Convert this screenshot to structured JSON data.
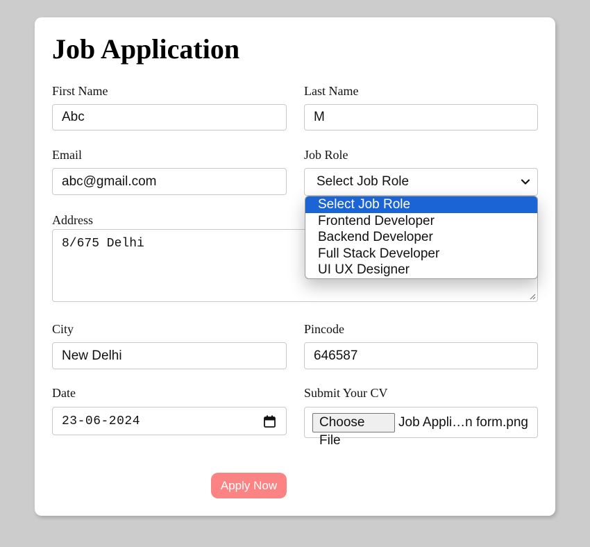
{
  "form": {
    "title": "Job Application",
    "first_name": {
      "label": "First Name",
      "value": "Abc"
    },
    "last_name": {
      "label": "Last Name",
      "value": "M"
    },
    "email": {
      "label": "Email",
      "value": "abc@gmail.com"
    },
    "job_role": {
      "label": "Job Role",
      "selected": "Select Job Role",
      "options": [
        "Select Job Role",
        "Frontend Developer",
        "Backend Developer",
        "Full Stack Developer",
        "UI UX Designer"
      ],
      "highlighted_index": 0
    },
    "address": {
      "label": "Address",
      "value": "8/675 Delhi"
    },
    "city": {
      "label": "City",
      "value": "New Delhi"
    },
    "pincode": {
      "label": "Pincode",
      "value": "646587"
    },
    "date": {
      "label": "Date",
      "value": "23-06-2024"
    },
    "cv": {
      "label": "Submit Your CV",
      "button_label": "Choose File",
      "file_name": "Job Appli…n form.png"
    },
    "submit_label": "Apply Now"
  },
  "colors": {
    "page_background": "#cccccc",
    "card_background": "#ffffff",
    "option_highlight": "#1a64d6",
    "apply_button": "#fc8383"
  }
}
